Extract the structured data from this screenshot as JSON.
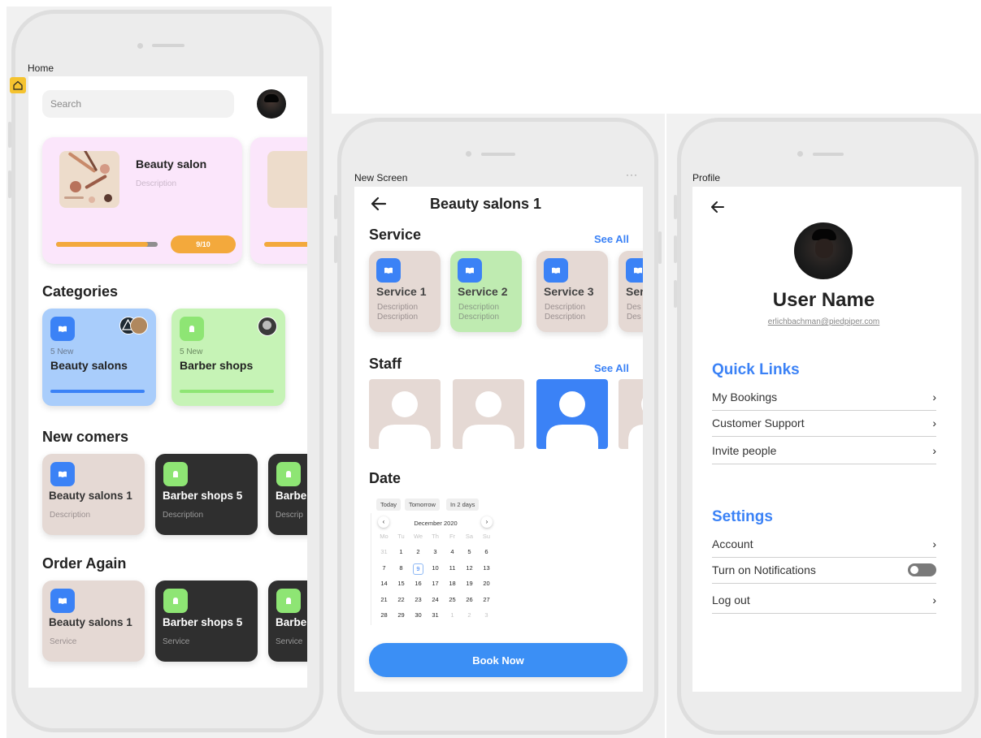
{
  "screens": {
    "home": {
      "frame_label": "Home",
      "search": {
        "placeholder": "Search"
      },
      "banner": {
        "title": "Beauty salon",
        "description": "Description",
        "progress_label": "9/10",
        "progress_fraction": 0.9
      },
      "categories": {
        "title": "Categories",
        "items": [
          {
            "count": "5 New",
            "label": "Beauty salons",
            "color": "#a9cdfb",
            "bar": "#3b82f6"
          },
          {
            "count": "5 New",
            "label": "Barber shops",
            "color": "#c6f3b6",
            "bar": "#8ee574"
          }
        ]
      },
      "new_comers": {
        "title": "New comers",
        "items": [
          {
            "label": "Beauty salons 1",
            "sub": "Description"
          },
          {
            "label": "Barber shops 5",
            "sub": "Description"
          },
          {
            "label": "Barbe",
            "sub": "Descrip"
          }
        ]
      },
      "order_again": {
        "title": "Order Again",
        "items": [
          {
            "label": "Beauty salons 1",
            "sub": "Service"
          },
          {
            "label": "Barber shops 5",
            "sub": "Service"
          },
          {
            "label": "Barbe",
            "sub": "Service"
          }
        ]
      }
    },
    "detail": {
      "frame_label": "New Screen",
      "frame_menu": "···",
      "title": "Beauty salons 1",
      "service": {
        "title": "Service",
        "see_all": "See All",
        "items": [
          {
            "name": "Service 1",
            "desc1": "Description",
            "desc2": "Description"
          },
          {
            "name": "Service 2",
            "desc1": "Description",
            "desc2": "Description"
          },
          {
            "name": "Service 3",
            "desc1": "Description",
            "desc2": "Description"
          },
          {
            "name": "Ser",
            "desc1": "Des",
            "desc2": "Des"
          }
        ]
      },
      "staff": {
        "title": "Staff",
        "see_all": "See All"
      },
      "date": {
        "title": "Date",
        "chips": [
          "Today",
          "Tomorrow",
          "In 2 days"
        ],
        "month": "December 2020",
        "weekdays": [
          "Mo",
          "Tu",
          "We",
          "Th",
          "Fr",
          "Sa",
          "Su"
        ],
        "weeks": [
          [
            "31",
            "1",
            "2",
            "3",
            "4",
            "5",
            "6"
          ],
          [
            "7",
            "8",
            "9",
            "10",
            "11",
            "12",
            "13"
          ],
          [
            "14",
            "15",
            "16",
            "17",
            "18",
            "19",
            "20"
          ],
          [
            "21",
            "22",
            "23",
            "24",
            "25",
            "26",
            "27"
          ],
          [
            "28",
            "29",
            "30",
            "31",
            "1",
            "2",
            "3"
          ]
        ],
        "selected_day": "9"
      },
      "book_button": "Book Now"
    },
    "profile": {
      "frame_label": "Profile",
      "user_name": "User Name",
      "email": "erlichbachman@piedpiper.com",
      "quick_links": {
        "title": "Quick Links",
        "items": [
          "My Bookings",
          "Customer Support",
          "Invite people"
        ]
      },
      "settings": {
        "title": "Settings",
        "items": [
          "Account",
          "Turn on Notifications",
          "Log out"
        ]
      }
    }
  },
  "colors": {
    "accent_blue": "#3b82f6",
    "green": "#8ee574",
    "beige": "#e5d9d4",
    "dark_card": "#2f2f2f",
    "banner_pink": "#fbe6fb",
    "progress_orange": "#f3a93c"
  }
}
